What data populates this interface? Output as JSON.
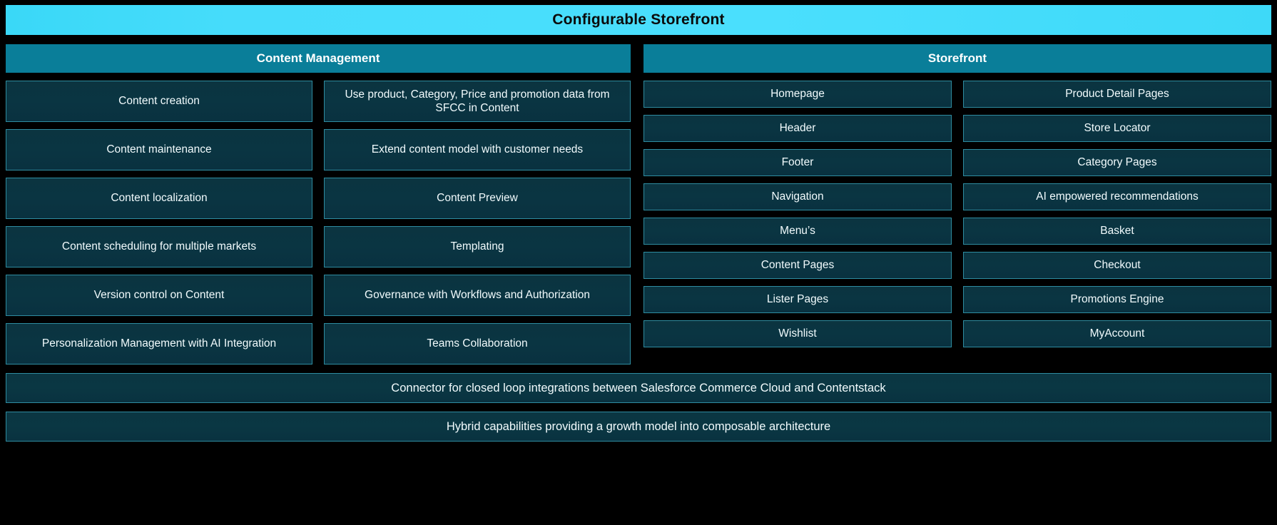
{
  "banner": {
    "title": "Configurable Storefront",
    "background_color": "#45dcfa",
    "text_color": "#0a0a0a"
  },
  "colors": {
    "page_background": "#000000",
    "section_header": "#0a7e99",
    "card_background": "#0a3542",
    "card_border": "#2e8ca0",
    "card_text": "#f2fbfd"
  },
  "sections": {
    "content_management": {
      "header": "Content Management",
      "columns": [
        {
          "items": [
            "Content creation",
            "Content maintenance",
            "Content localization",
            "Content scheduling for multiple markets",
            "Version control on Content",
            "Personalization Management with AI Integration"
          ]
        },
        {
          "items": [
            "Use product, Category, Price and promotion data from SFCC in Content",
            "Extend content model with customer needs",
            "Content Preview",
            "Templating",
            "Governance with Workflows and Authorization",
            "Teams Collaboration"
          ]
        }
      ]
    },
    "storefront": {
      "header": "Storefront",
      "columns": [
        {
          "items": [
            "Homepage",
            "Header",
            "Footer",
            "Navigation",
            "Menu’s",
            "Content Pages",
            "Lister Pages",
            "Wishlist"
          ]
        },
        {
          "items": [
            "Product Detail Pages",
            "Store Locator",
            "Category Pages",
            "AI empowered recommendations",
            "Basket",
            "Checkout",
            "Promotions Engine",
            "MyAccount"
          ]
        }
      ]
    }
  },
  "bottom_bars": [
    "Connector for closed loop integrations between Salesforce Commerce Cloud and Contentstack",
    "Hybrid capabilities providing a growth model into composable architecture"
  ]
}
